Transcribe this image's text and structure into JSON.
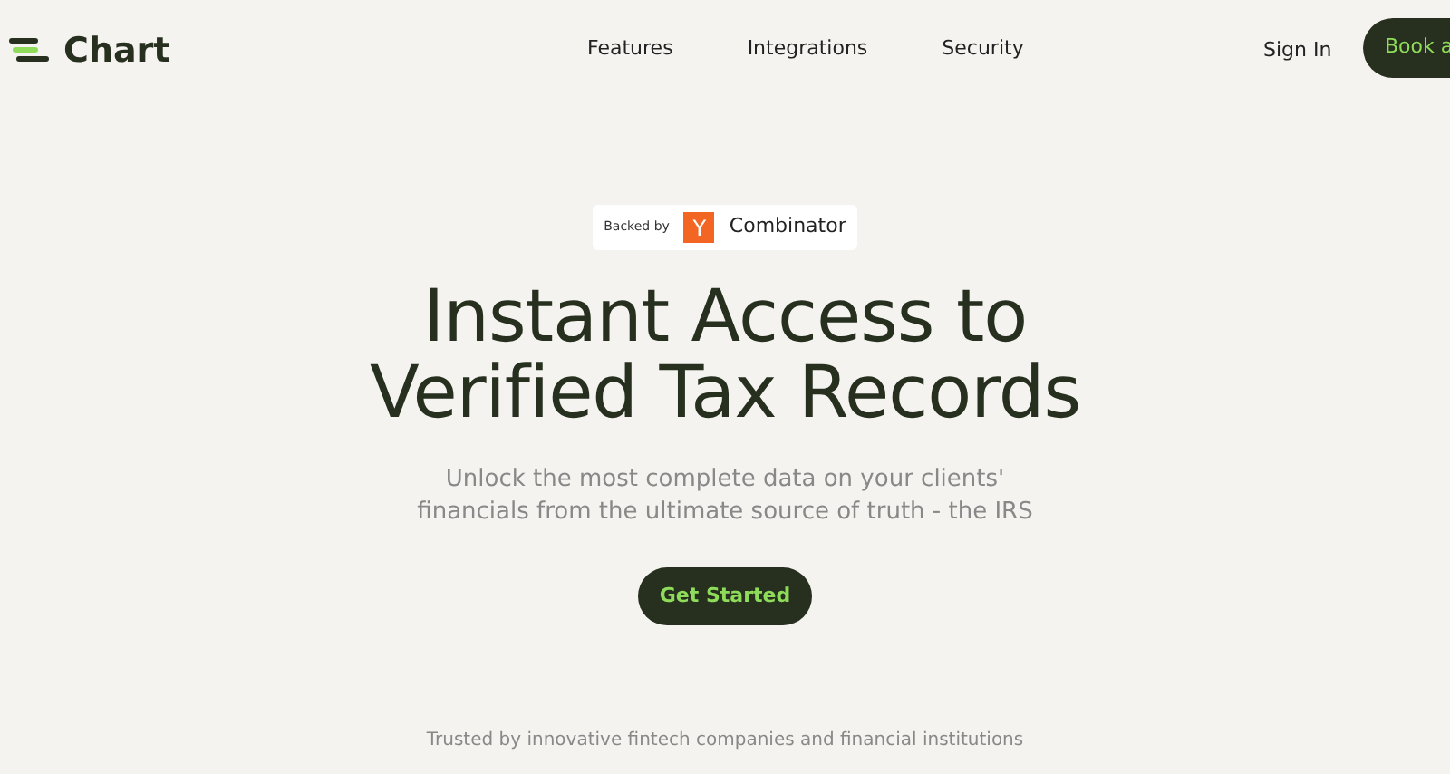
{
  "brand": {
    "name": "Chart"
  },
  "nav": [
    "Features",
    "Integrations",
    "Security"
  ],
  "sign_in": "Sign In",
  "cta_top": "Book a",
  "badge": {
    "prefix": "Backed by",
    "logo_letter": "Y",
    "name": "Combinator"
  },
  "heading": [
    "Instant Access to",
    "Verified Tax Records"
  ],
  "subtitle": [
    "Unlock the most complete data on your clients'",
    "financials from the ultimate source of truth - the IRS"
  ],
  "cta": "Get Started",
  "trusted": "Trusted by innovative fintech companies and financial institutions"
}
